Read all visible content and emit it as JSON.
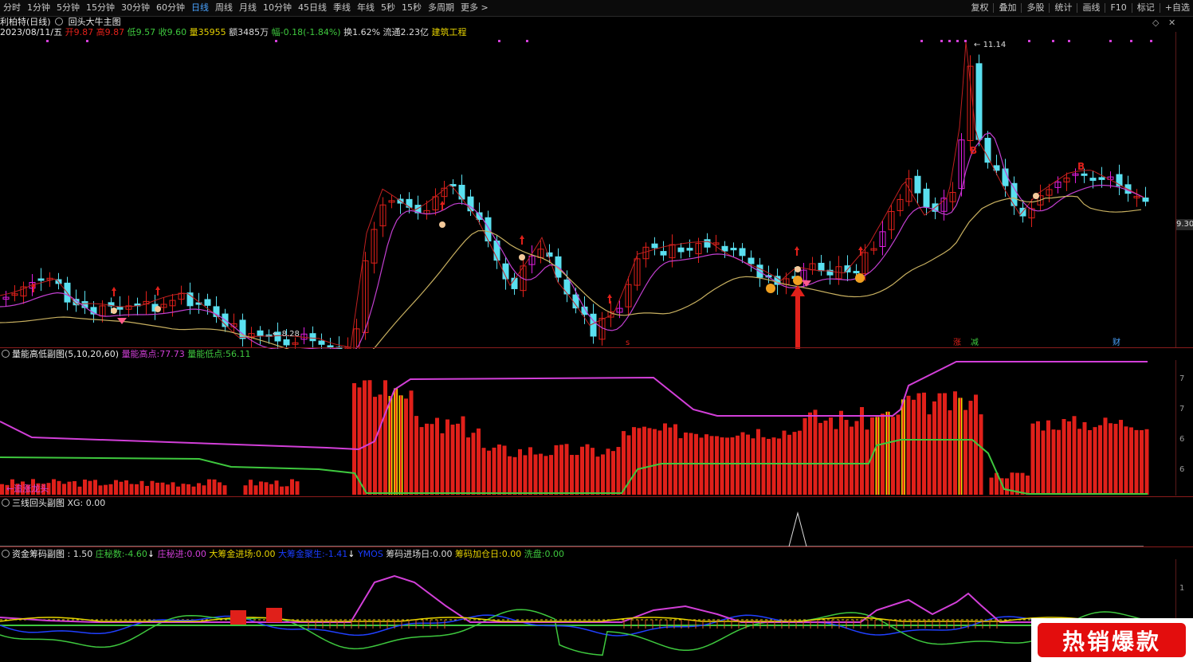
{
  "colors": {
    "up": "#e0201a",
    "down": "#5ae0f0",
    "accent": "#4aa3ff",
    "magenta": "#d23fd8",
    "yellow": "#e6d200",
    "green": "#3ec83e"
  },
  "toolbar": {
    "periods": [
      "分时",
      "1分钟",
      "5分钟",
      "15分钟",
      "30分钟",
      "60分钟",
      "日线",
      "周线",
      "月线",
      "10分钟",
      "45日线",
      "季线",
      "年线",
      "5秒",
      "15秒",
      "多周期",
      "更多 >"
    ],
    "active": "日线",
    "right": [
      "复权",
      "叠加",
      "多股",
      "统计",
      "画线",
      "F10",
      "标记",
      "+自选"
    ],
    "close_icon": "close-icon"
  },
  "main": {
    "title": "利柏特(日线)",
    "indicator": "回头大牛主图",
    "date": "2023/08/11/五",
    "open_label": "开",
    "open": "9.87",
    "high_label": "高",
    "high": "9.87",
    "low_label": "低",
    "low": "9.57",
    "close_label": "收",
    "close": "9.60",
    "vol_label": "量",
    "vol": "35955",
    "amt_label": "额",
    "amt": "3485万",
    "chg_label": "幅",
    "chg": "-0.18(-1.84%)",
    "turn_label": "换",
    "turn": "1.62%",
    "float_label": "流通",
    "float": "2.23亿",
    "sector": "建筑工程",
    "high_mark": "11.14",
    "low_mark": "8.28",
    "price_tag": "9.30",
    "label_s": "s",
    "label_zhang": "涨",
    "label_jian": "减",
    "label_cai": "财",
    "label_b": "B"
  },
  "sub1": {
    "title": "量能高低副图(5,10,20,60)",
    "high_label": "量能高点:",
    "high_val": "77.73",
    "low_label": "量能低点:",
    "low_val": "56.11",
    "note": "←追涨龙头",
    "yticks": [
      "7",
      "7",
      "6",
      "6"
    ]
  },
  "sub2": {
    "title": "三线回头副图",
    "xg_label": "XG:",
    "xg_val": "0.00"
  },
  "sub3": {
    "title": "资金筹码副图",
    "v1": ": 1.50",
    "zhuang_label": "庄秘数:",
    "zhuang_val": "-4.60",
    "zmj_label": "庄秘进:",
    "zmj_val": "0.00",
    "dcj_label": "大筹金进场:",
    "dcj_val": "0.00",
    "dcjfs_label": "大筹金聚生:",
    "dcjfs_val": "-1.41",
    "ymos": "YMOS",
    "cmjcr_label": "筹码进场日:",
    "cmjcr_val": "0.00",
    "cmjcr2_label": "筹码加仓日:",
    "cmjcr2_val": "0.00",
    "xp_label": "洗盘:",
    "xp_val": "0.00",
    "ytick": "1"
  },
  "promo": {
    "text": "热销爆款"
  }
}
